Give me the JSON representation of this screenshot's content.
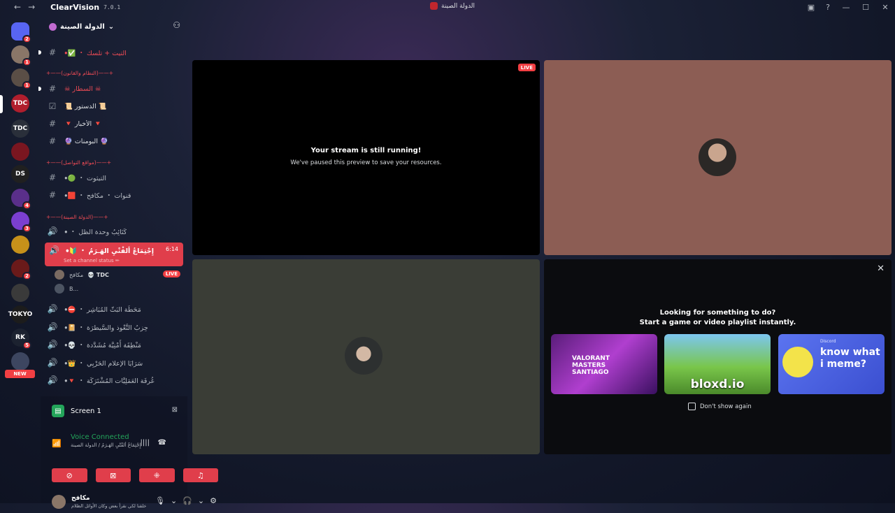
{
  "titlebar": {
    "back_icon": "arrow-left-icon",
    "forward_icon": "arrow-right-icon",
    "app_name": "ClearVision",
    "version": "7.0.1",
    "window_title": "الدولة الصينة",
    "right_icons": [
      "inbox-icon",
      "help-icon"
    ],
    "window_controls": [
      "minimize-icon",
      "maximize-icon",
      "close-icon"
    ]
  },
  "rail": {
    "servers": [
      {
        "abbr": "",
        "color": "#5865f2",
        "badge": "2"
      },
      {
        "abbr": "",
        "color": "#8a7668",
        "badge": "1"
      },
      {
        "abbr": "",
        "color": "#5a4e46",
        "badge": "1"
      },
      {
        "abbr": "TDC",
        "color": "#b01e2d",
        "badge": ""
      },
      {
        "abbr": "TDC",
        "color": "#2a2f3a",
        "badge": ""
      },
      {
        "abbr": "",
        "color": "#7a1620",
        "badge": ""
      },
      {
        "abbr": "DS",
        "color": "#202020",
        "badge": ""
      },
      {
        "abbr": "",
        "color": "#5a2f8a",
        "badge": "4"
      },
      {
        "abbr": "",
        "color": "#7b3fd0",
        "badge": "3"
      },
      {
        "abbr": "",
        "color": "#c6911a",
        "badge": ""
      },
      {
        "abbr": "",
        "color": "#6a1a1a",
        "badge": "2"
      },
      {
        "abbr": "",
        "color": "#3a3a3a",
        "badge": ""
      },
      {
        "abbr": "TOKYO",
        "color": "#1c1c1c",
        "badge": ""
      },
      {
        "abbr": "RK",
        "color": "#1c2230",
        "badge": "5"
      },
      {
        "abbr": "",
        "color": "#3d4660",
        "badge": ""
      }
    ],
    "new_label": "NEW"
  },
  "sidebar": {
    "guild_name": "الدولة الصينة",
    "chevron_icon": "chevron-down-icon",
    "invite_icon": "add-member-icon",
    "rows": [
      {
        "kind": "channel",
        "sym": "#",
        "name": "ꔷ✅ ・ التيت + تلسك",
        "style": "red",
        "unread": true
      },
      {
        "kind": "category",
        "name": "+——(النظام والقانون)——+"
      },
      {
        "kind": "channel",
        "sym": "#",
        "name": "☠︎ السطار ☠︎",
        "style": "red",
        "unread": true
      },
      {
        "kind": "channel",
        "sym": "☑",
        "name": "📜 الدستور 📜",
        "style": "bright",
        "unread": false
      },
      {
        "kind": "channel",
        "sym": "#",
        "name": "🔻 الأخبار 🔻",
        "style": "bright",
        "unread": false
      },
      {
        "kind": "channel",
        "sym": "#",
        "name": "🔮 البومنات 🔮",
        "style": "bright",
        "unread": false
      },
      {
        "kind": "category",
        "name": "+——(مواقع التواصل)——+"
      },
      {
        "kind": "channel",
        "sym": "#",
        "name": "ꔷ🟢 ・ التيثوت",
        "style": "normal",
        "unread": false
      },
      {
        "kind": "channel",
        "sym": "#",
        "name": "ꔷ🟥 ・ قنوات ・ مكافح",
        "style": "normal",
        "unread": false
      },
      {
        "kind": "category",
        "name": "+——(الدولة الصينة)——+"
      },
      {
        "kind": "voice",
        "sym": "🔊",
        "name": "ꔷ ・ كَتَائِبُ وحدة الظل",
        "style": "normal",
        "unread": false
      }
    ],
    "active_channel": {
      "name": "ꔷ🔰 ・ إِجْتِمَاعُ ألفْتْيِ الهَـرَمُ",
      "time": "6:14",
      "status": "Set a channel status ✏"
    },
    "voice_users": [
      {
        "name": "مكافح",
        "tag": "💀 TDC",
        "live": "LIVE"
      },
      {
        "name": "B...",
        "tag": "",
        "live": ""
      }
    ],
    "voice_rows": [
      {
        "sym": "🔊",
        "name": "ꔷ⛔ ・ مَحَطَة البَثّ المُبَاشِر"
      },
      {
        "sym": "🔊",
        "name": "ꔷ📔 ・ حِزبُ التَّعْوِذ والسَّيطرَة"
      },
      {
        "sym": "🔊",
        "name": "ꔷ💀 ・ مَنْطِقَة أَمْنِيَّة مُشَدَّدة"
      },
      {
        "sym": "🔊",
        "name": "ꔷ👑 ・ سَرَايَا الإعلام الحَرْبِي"
      },
      {
        "sym": "🔊",
        "name": "ꔷ🔻 ・ غُرفَة العَمَلِيَّات المُشْتَرَكَة"
      }
    ]
  },
  "panel": {
    "screen_label": "Screen 1",
    "voice_status": "Voice Connected",
    "voice_sub": "إِجْتِمَاعُ ألفْتْيِ الهَـرَمُ / الدولة الصينة",
    "actions": [
      "camera-off-icon",
      "stop-share-icon",
      "activity-icon",
      "soundboard-icon"
    ],
    "user_name": "مكافح",
    "user_status": "خلقنا لكي نقرأ بعض وكان الأوائل الظلام"
  },
  "stream": {
    "live": "LIVE",
    "heading": "Your stream is still running!",
    "sub": "We've paused this preview to save your resources."
  },
  "activity": {
    "line1": "Looking for something to do?",
    "line2": "Start a game or video playlist instantly.",
    "cards": [
      {
        "title": "VALORANT MASTERS SANTIAGO"
      },
      {
        "title": "bloxd.io"
      },
      {
        "brand": "Discord",
        "title": "know what i meme?"
      }
    ],
    "dont_show": "Don't show again"
  }
}
